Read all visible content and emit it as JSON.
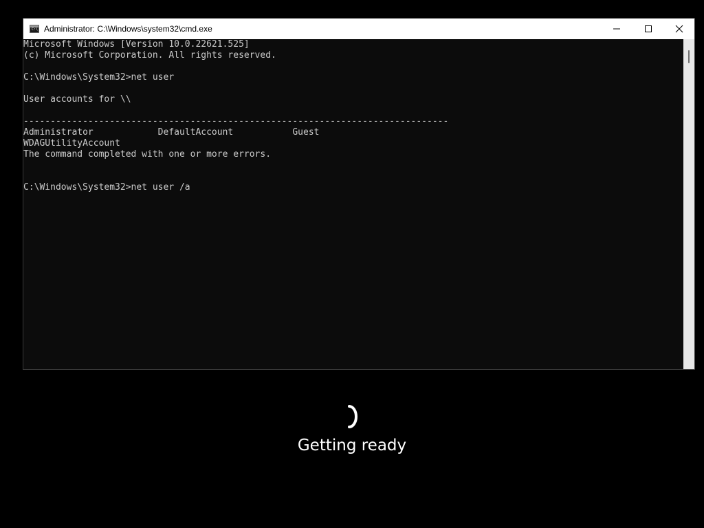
{
  "window": {
    "title": "Administrator: C:\\Windows\\system32\\cmd.exe",
    "icon": "cmd-icon",
    "icon_text": "C:\\"
  },
  "console": {
    "lines": [
      "Microsoft Windows [Version 10.0.22621.525]",
      "(c) Microsoft Corporation. All rights reserved.",
      "",
      "C:\\Windows\\System32>net user",
      "",
      "User accounts for \\\\",
      "",
      "-------------------------------------------------------------------------------",
      "Administrator            DefaultAccount           Guest",
      "WDAGUtilityAccount",
      "The command completed with one or more errors.",
      "",
      "",
      "C:\\Windows\\System32>net user /a"
    ]
  },
  "controls": {
    "minimize": "minimize-icon",
    "maximize": "maximize-icon",
    "close": "close-icon"
  },
  "status": {
    "text": "Getting ready",
    "spinner": "loading-spinner-icon"
  },
  "colors": {
    "console_bg": "#0c0c0c",
    "console_text": "#cccccc",
    "titlebar_bg": "#ffffff",
    "screen_bg": "#000000",
    "status_text": "#ffffff"
  }
}
